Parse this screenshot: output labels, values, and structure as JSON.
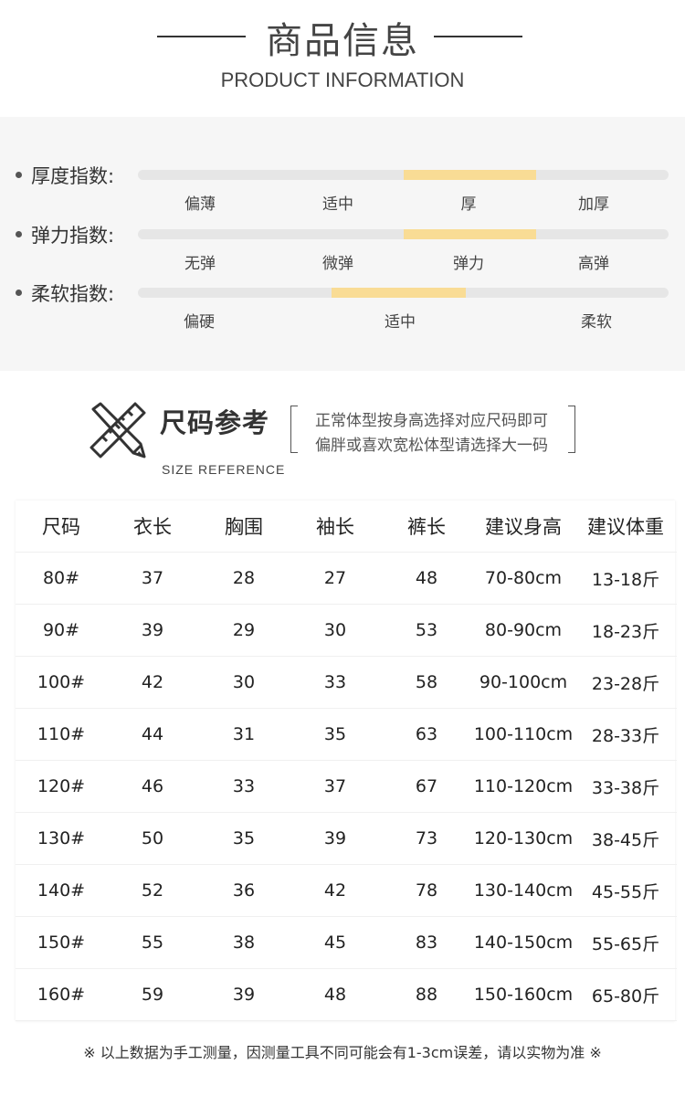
{
  "header": {
    "title": "商品信息",
    "subtitle": "PRODUCT INFORMATION"
  },
  "indices": [
    {
      "label": "厚度指数:",
      "ticks": [
        "偏薄",
        "适中",
        "厚",
        "加厚"
      ],
      "selected_index": 2
    },
    {
      "label": "弹力指数:",
      "ticks": [
        "无弹",
        "微弹",
        "弹力",
        "高弹"
      ],
      "selected_index": 2
    },
    {
      "label": "柔软指数:",
      "ticks": [
        "偏硬",
        "适中",
        "柔软"
      ],
      "selected_index": 1
    }
  ],
  "colors": {
    "highlight": "#f9dc95",
    "track": "#e6e6e6",
    "panel_bg": "#f6f6f6"
  },
  "size_section": {
    "title": "尺码参考",
    "subtitle": "SIZE REFERENCE",
    "icon": "ruler-pencil-icon",
    "note_line1": "正常体型按身高选择对应尺码即可",
    "note_line2": "偏胖或喜欢宽松体型请选择大一码"
  },
  "table": {
    "headers": [
      "尺码",
      "衣长",
      "胸围",
      "袖长",
      "裤长",
      "建议身高",
      "建议体重"
    ],
    "rows": [
      [
        "80#",
        "37",
        "28",
        "27",
        "48",
        "70-80cm",
        "13-18斤"
      ],
      [
        "90#",
        "39",
        "29",
        "30",
        "53",
        "80-90cm",
        "18-23斤"
      ],
      [
        "100#",
        "42",
        "30",
        "33",
        "58",
        "90-100cm",
        "23-28斤"
      ],
      [
        "110#",
        "44",
        "31",
        "35",
        "63",
        "100-110cm",
        "28-33斤"
      ],
      [
        "120#",
        "46",
        "33",
        "37",
        "67",
        "110-120cm",
        "33-38斤"
      ],
      [
        "130#",
        "50",
        "35",
        "39",
        "73",
        "120-130cm",
        "38-45斤"
      ],
      [
        "140#",
        "52",
        "36",
        "42",
        "78",
        "130-140cm",
        "45-55斤"
      ],
      [
        "150#",
        "55",
        "38",
        "45",
        "83",
        "140-150cm",
        "55-65斤"
      ],
      [
        "160#",
        "59",
        "39",
        "48",
        "88",
        "150-160cm",
        "65-80斤"
      ]
    ]
  },
  "footnote": "※ 以上数据为手工测量，因测量工具不同可能会有1-3cm误差，请以实物为准 ※"
}
